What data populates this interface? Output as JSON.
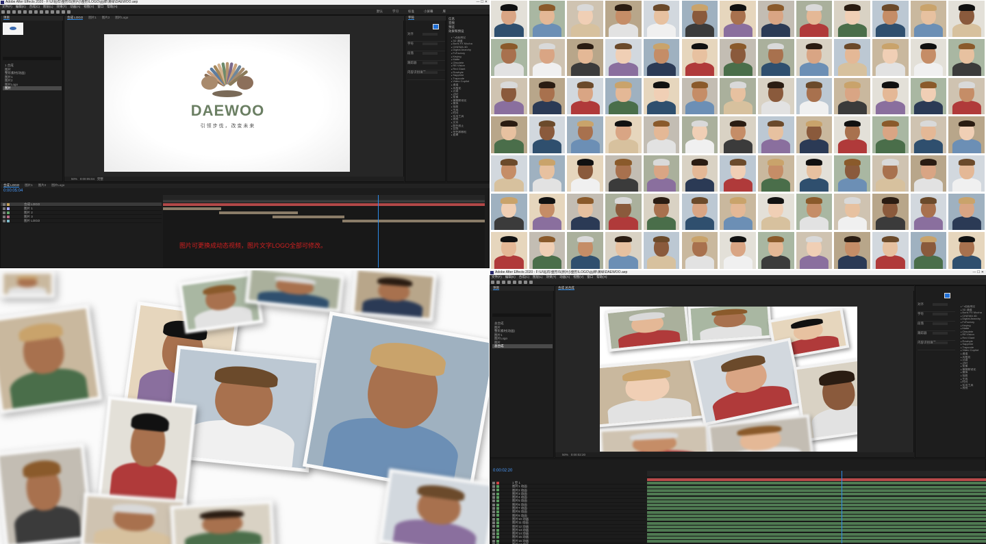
{
  "tl": {
    "title": "Adobe After Effects 2020 - F:\\U\\钻石\\整形\\5(照片)\\整形\\LOGO\\品牌\\演绎\\DAEWOO.aep",
    "menu": [
      "文件(F)",
      "编辑(E)",
      "合成(C)",
      "图层(L)",
      "效果(T)",
      "动画(A)",
      "视图(V)",
      "窗口",
      "帮助(H)"
    ],
    "workspace": [
      "默认",
      "学习",
      "标准",
      "小屏幕",
      "库"
    ],
    "project_tab": "项目",
    "comp_tabs": [
      "合成 LOGO",
      "图片1",
      "图片2",
      "图片Logo"
    ],
    "project_items": [
      "1 合成",
      "图片",
      "整形素材(动画)",
      "图片1",
      "图片2",
      "图片Logo",
      "图片"
    ],
    "logo_text": "DAEWOO",
    "slogan": "引 领 步 伐 ， 改 变 未 来",
    "info_panels": [
      "信息",
      "音频",
      "预览",
      "效果和预设"
    ],
    "effects_list": [
      "* 动画预设",
      "3D 通道",
      "Boris FX Mocha",
      "CINEMA 4D",
      "Digital Anarchy",
      "FxFactory",
      "Keying",
      "Matte",
      "Obsolete",
      "RE:Vision",
      "Red Giant",
      "Rowbyte",
      "Sapphire",
      "Trapcode",
      "Video Copilot",
      "通道",
      "风格化",
      "过渡",
      "过时",
      "抠像",
      "模糊和锐化",
      "模拟",
      "扭曲",
      "生成",
      "时间",
      "实用工具",
      "透视",
      "文本",
      "颜色校正",
      "音频",
      "杂色和颗粒",
      "遮罩"
    ],
    "right_labels": [
      "对齐",
      "字符",
      "段落",
      "跟踪器",
      "内容识别填充"
    ],
    "timecode": "0:00:05:04",
    "layers": [
      "合成 LOGO",
      "图片 1",
      "图片 2",
      "图片 3",
      "图片 LOGO"
    ],
    "note": "图片可更换成动态视频，图片文字LOGO全部可修改。",
    "zoom": "50%",
    "quality": "完整"
  },
  "br": {
    "title": "Adobe After Effects 2020 - F:\\U\\钻石\\整形\\5(照片)\\整形\\LOGO\\品牌\\演绎\\DAEWOO.aep",
    "menu": [
      "文件(F)",
      "编辑(E)",
      "合成(C)",
      "图层(L)",
      "效果(T)",
      "动画(A)",
      "视图(V)",
      "窗口",
      "帮助(H)"
    ],
    "project_tab": "项目",
    "comp_tab": "合成 总合成",
    "project_items": [
      "总合成",
      "图片",
      "整形素材(动画)",
      "图片1",
      "图片Logo",
      "图片",
      "总合成"
    ],
    "timecode": "0:00:02:20",
    "layers": [
      "1 空 1",
      "图片1 动画",
      "图片2 动画",
      "图片3 动画",
      "图片4 动画",
      "图片5 动画",
      "图片6 动画",
      "图片7 动画",
      "图片8 动画",
      "图片9 动画",
      "图片10 动画",
      "图片11 动画",
      "图片12 动画",
      "图片13 动画",
      "图片14 动画",
      "图片15 动画",
      "图片16 动画",
      "图片17 动画"
    ],
    "zoom": "50%"
  },
  "colors": {
    "ae_bg": "#1d1d1d",
    "accent": "#2d8ceb",
    "track_red": "#b94a4a",
    "track_green": "#4f7a52",
    "note_red": "#d12020"
  }
}
